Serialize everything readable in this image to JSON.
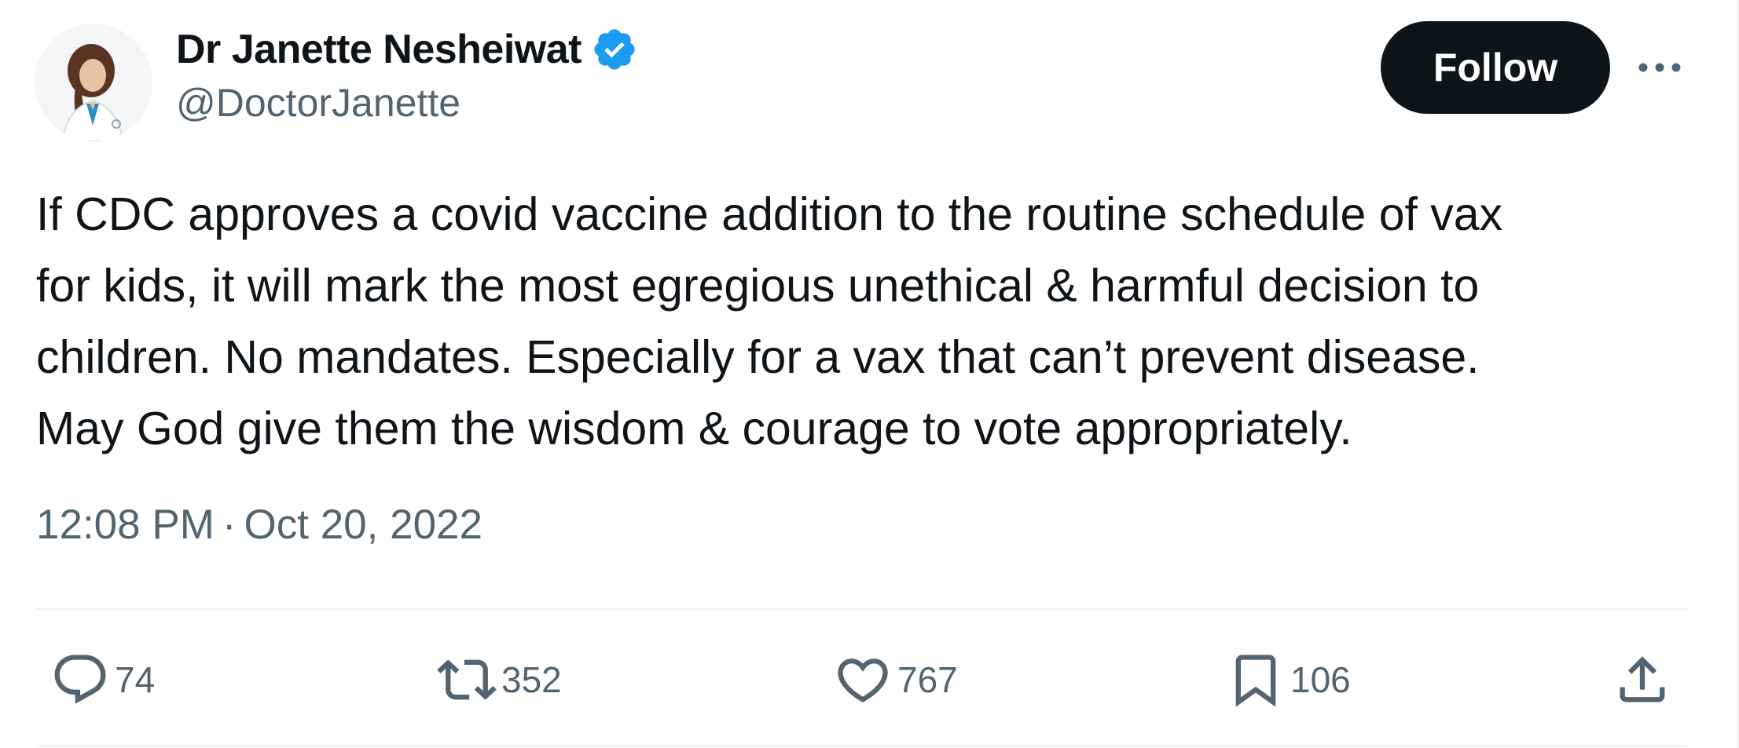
{
  "author": {
    "display_name": "Dr Janette Nesheiwat",
    "handle": "@DoctorJanette",
    "verified_icon": "verified-badge-icon",
    "verified_color": "#1d9bf0"
  },
  "header_actions": {
    "follow_label": "Follow",
    "more_icon": "more-horizontal-icon"
  },
  "tweet": {
    "lines": [
      "If CDC approves a covid vaccine  addition to the routine schedule of vax",
      "for kids, it will mark the most egregious unethical & harmful decision to",
      "children. No mandates. Especially for a vax that can’t prevent disease.",
      "May God give them the wisdom & courage to vote appropriately."
    ],
    "time": "12:08 PM",
    "separator": "·",
    "date": "Oct 20, 2022"
  },
  "actions": {
    "reply": {
      "icon": "reply-icon",
      "count": "74"
    },
    "retweet": {
      "icon": "retweet-icon",
      "count": "352"
    },
    "like": {
      "icon": "heart-icon",
      "count": "767"
    },
    "bookmark": {
      "icon": "bookmark-icon",
      "count": "106"
    },
    "share": {
      "icon": "share-icon"
    }
  },
  "colors": {
    "text_primary": "#0f1419",
    "text_secondary": "#536471",
    "follow_bg": "#0f1419",
    "divider": "#eff3f4"
  }
}
